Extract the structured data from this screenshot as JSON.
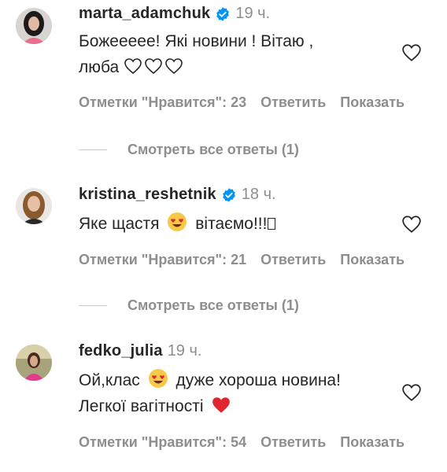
{
  "comments": [
    {
      "username": "marta_adamchuk",
      "time": "19 ч.",
      "line1": "Божеееее! Які новини ! Вітаю ,",
      "line2": "люба",
      "likes": "Отметки \"Нравится\": 23",
      "reply": "Ответить",
      "show": "Показать",
      "view_replies": "Смотреть все ответы (1)",
      "verified": true
    },
    {
      "username": "kristina_reshetnik",
      "time": "18 ч.",
      "text_before": "Яке щастя",
      "text_after": "вітаємо!!!",
      "likes": "Отметки \"Нравится\": 21",
      "reply": "Ответить",
      "show": "Показать",
      "view_replies": "Смотреть все ответы (1)",
      "verified": true
    },
    {
      "username": "fedko_julia",
      "time": "19 ч.",
      "text_before": "Ой,клас",
      "text_after": "дуже хороша новина!",
      "line2": "Легкої вагітності",
      "likes": "Отметки \"Нравится\": 54",
      "reply": "Ответить",
      "show": "Показать",
      "verified": false
    }
  ],
  "colors": {
    "verified_blue": "#0095f6",
    "secondary_text": "#8e8e8e",
    "primary_text": "#262626",
    "red_heart": "#e0252f"
  }
}
